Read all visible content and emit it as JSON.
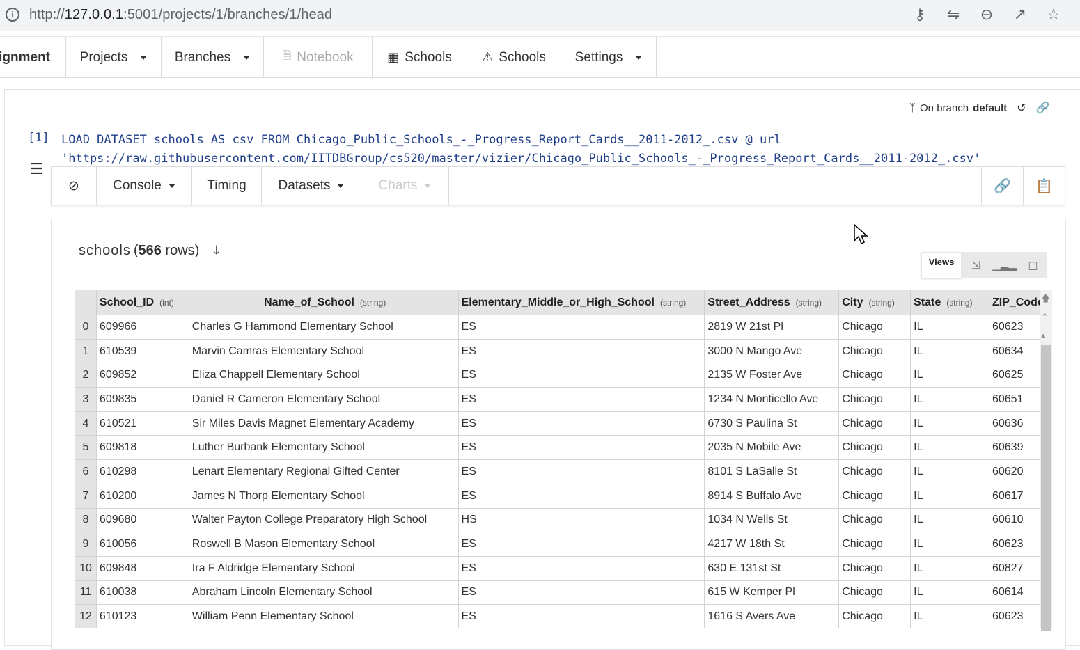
{
  "browser": {
    "url_prefix": "http://",
    "url_host": "127.0.0.1",
    "url_rest": ":5001/projects/1/branches/1/head",
    "icons": [
      "key-icon",
      "translate-icon",
      "zoom-out-icon",
      "share-icon",
      "star-icon"
    ]
  },
  "navbar": {
    "brand": "signment",
    "projects": "Projects",
    "branches": "Branches",
    "notebook": "Notebook",
    "schools_table": "Schools",
    "schools_warning": "Schools",
    "settings": "Settings"
  },
  "branch": {
    "prefix": "On branch",
    "name": "default"
  },
  "cell": {
    "index": "[1]",
    "code_line1": "LOAD DATASET schools AS csv FROM Chicago_Public_Schools_-_Progress_Report_Cards__2011-2012_.csv @ url",
    "code_line2": "'https://raw.githubusercontent.com/IITDBGroup/cs520/master/vizier/Chicago_Public_Schools_-_Progress_Report_Cards__2011-2012_.csv'"
  },
  "celltools": {
    "console": "Console",
    "timing": "Timing",
    "datasets": "Datasets",
    "charts": "Charts"
  },
  "dataset": {
    "name": "schools",
    "open_paren": "(",
    "row_count": "566",
    "rows_suffix": "rows)",
    "views_label": "Views"
  },
  "table": {
    "columns": [
      {
        "name": "School_ID",
        "type": "(int)"
      },
      {
        "name": "Name_of_School",
        "type": "(string)"
      },
      {
        "name": "Elementary_Middle_or_High_School",
        "type": "(string)"
      },
      {
        "name": "Street_Address",
        "type": "(string)"
      },
      {
        "name": "City",
        "type": "(string)"
      },
      {
        "name": "State",
        "type": "(string)"
      },
      {
        "name": "ZIP_Code",
        "type": ""
      }
    ],
    "rows": [
      [
        "0",
        "609966",
        "Charles G Hammond Elementary School",
        "ES",
        "2819 W 21st Pl",
        "Chicago",
        "IL",
        "60623"
      ],
      [
        "1",
        "610539",
        "Marvin Camras Elementary School",
        "ES",
        "3000 N Mango Ave",
        "Chicago",
        "IL",
        "60634"
      ],
      [
        "2",
        "609852",
        "Eliza Chappell Elementary School",
        "ES",
        "2135 W Foster Ave",
        "Chicago",
        "IL",
        "60625"
      ],
      [
        "3",
        "609835",
        "Daniel R Cameron Elementary School",
        "ES",
        "1234 N Monticello Ave",
        "Chicago",
        "IL",
        "60651"
      ],
      [
        "4",
        "610521",
        "Sir Miles Davis Magnet Elementary Academy",
        "ES",
        "6730 S Paulina St",
        "Chicago",
        "IL",
        "60636"
      ],
      [
        "5",
        "609818",
        "Luther Burbank Elementary School",
        "ES",
        "2035 N Mobile Ave",
        "Chicago",
        "IL",
        "60639"
      ],
      [
        "6",
        "610298",
        "Lenart Elementary Regional Gifted Center",
        "ES",
        "8101 S LaSalle St",
        "Chicago",
        "IL",
        "60620"
      ],
      [
        "7",
        "610200",
        "James N Thorp Elementary School",
        "ES",
        "8914 S Buffalo Ave",
        "Chicago",
        "IL",
        "60617"
      ],
      [
        "8",
        "609680",
        "Walter Payton College Preparatory High School",
        "HS",
        "1034 N Wells St",
        "Chicago",
        "IL",
        "60610"
      ],
      [
        "9",
        "610056",
        "Roswell B Mason Elementary School",
        "ES",
        "4217 W 18th St",
        "Chicago",
        "IL",
        "60623"
      ],
      [
        "10",
        "609848",
        "Ira F Aldridge Elementary School",
        "ES",
        "630 E 131st St",
        "Chicago",
        "IL",
        "60827"
      ],
      [
        "11",
        "610038",
        "Abraham Lincoln Elementary School",
        "ES",
        "615 W Kemper Pl",
        "Chicago",
        "IL",
        "60614"
      ],
      [
        "12",
        "610123",
        "William Penn Elementary School",
        "ES",
        "1616 S Avers Ave",
        "Chicago",
        "IL",
        "60623"
      ]
    ]
  }
}
